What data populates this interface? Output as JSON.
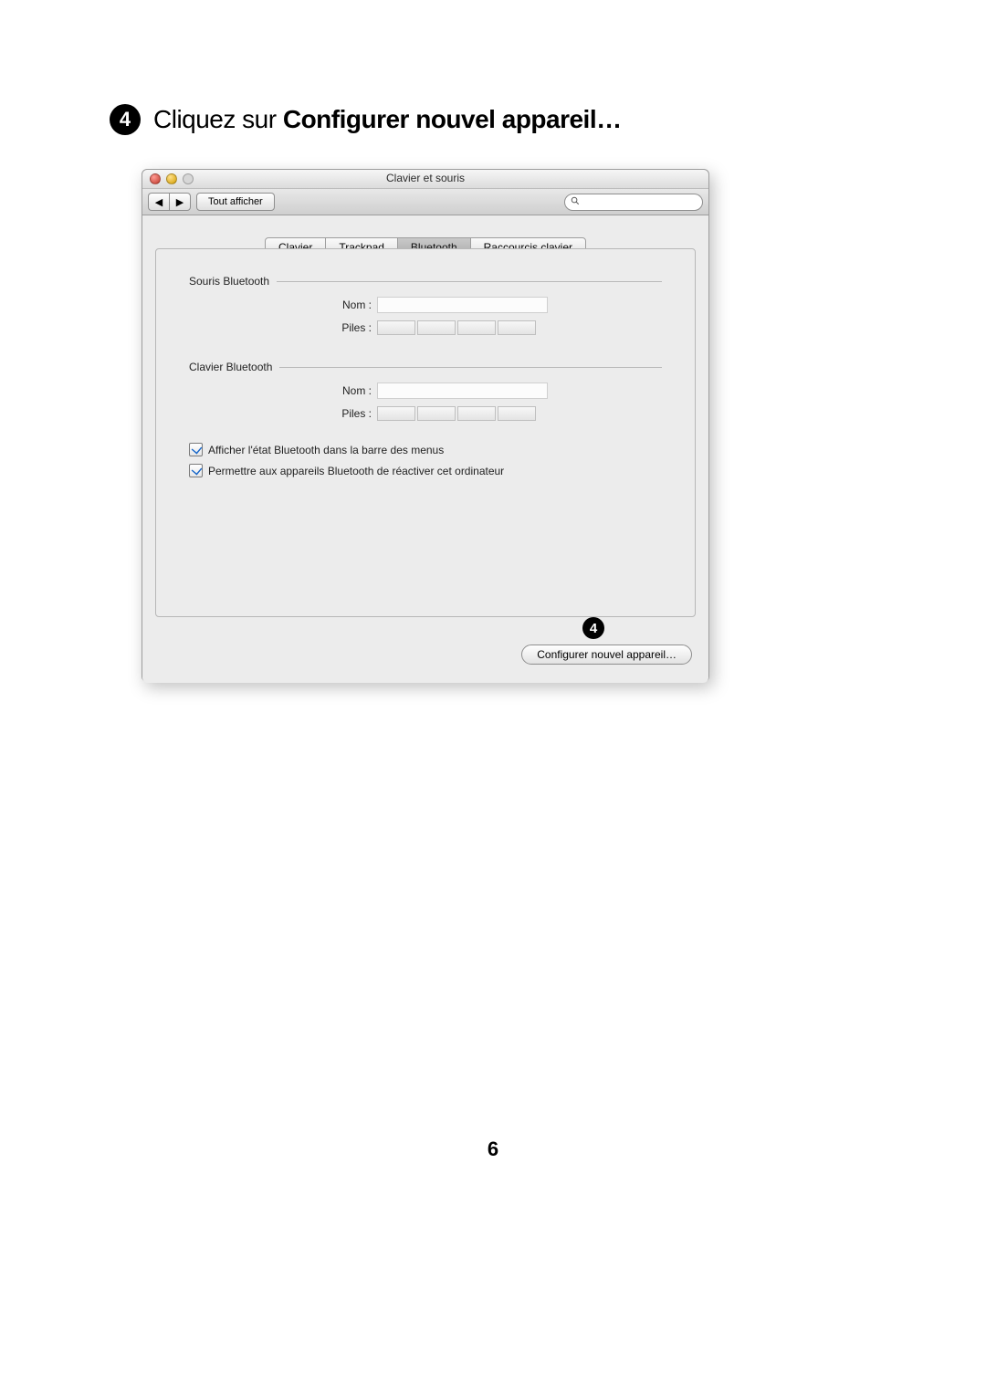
{
  "step_number": "4",
  "instruction_prefix": "Cliquez sur ",
  "instruction_bold": "Configurer nouvel appareil…",
  "window": {
    "title": "Clavier et souris",
    "toolbar": {
      "back_glyph": "◀",
      "forward_glyph": "▶",
      "show_all": "Tout afficher"
    },
    "search_placeholder": "",
    "tabs": [
      "Clavier",
      "Trackpad",
      "Bluetooth",
      "Raccourcis clavier"
    ],
    "selected_tab_index": 2,
    "mouse_section": {
      "header": "Souris Bluetooth",
      "name_label": "Nom :",
      "battery_label": "Piles :"
    },
    "keyboard_section": {
      "header": "Clavier Bluetooth",
      "name_label": "Nom :",
      "battery_label": "Piles :"
    },
    "checkbox1": "Afficher l'état Bluetooth dans la barre des menus",
    "checkbox2": "Permettre aux appareils Bluetooth de réactiver cet ordinateur",
    "callout_number": "4",
    "config_button": "Configurer nouvel appareil…"
  },
  "page_number": "6"
}
